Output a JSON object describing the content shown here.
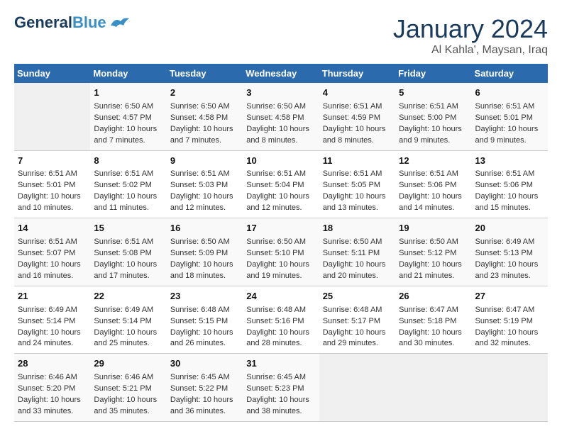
{
  "header": {
    "logo_general": "General",
    "logo_blue": "Blue",
    "month": "January 2024",
    "location": "Al Kahla', Maysan, Iraq"
  },
  "days_of_week": [
    "Sunday",
    "Monday",
    "Tuesday",
    "Wednesday",
    "Thursday",
    "Friday",
    "Saturday"
  ],
  "weeks": [
    [
      {
        "day": "",
        "sunrise": "",
        "sunset": "",
        "daylight": "",
        "empty": true
      },
      {
        "day": "1",
        "sunrise": "Sunrise: 6:50 AM",
        "sunset": "Sunset: 4:57 PM",
        "daylight": "Daylight: 10 hours and 7 minutes."
      },
      {
        "day": "2",
        "sunrise": "Sunrise: 6:50 AM",
        "sunset": "Sunset: 4:58 PM",
        "daylight": "Daylight: 10 hours and 7 minutes."
      },
      {
        "day": "3",
        "sunrise": "Sunrise: 6:50 AM",
        "sunset": "Sunset: 4:58 PM",
        "daylight": "Daylight: 10 hours and 8 minutes."
      },
      {
        "day": "4",
        "sunrise": "Sunrise: 6:51 AM",
        "sunset": "Sunset: 4:59 PM",
        "daylight": "Daylight: 10 hours and 8 minutes."
      },
      {
        "day": "5",
        "sunrise": "Sunrise: 6:51 AM",
        "sunset": "Sunset: 5:00 PM",
        "daylight": "Daylight: 10 hours and 9 minutes."
      },
      {
        "day": "6",
        "sunrise": "Sunrise: 6:51 AM",
        "sunset": "Sunset: 5:01 PM",
        "daylight": "Daylight: 10 hours and 9 minutes."
      }
    ],
    [
      {
        "day": "7",
        "sunrise": "Sunrise: 6:51 AM",
        "sunset": "Sunset: 5:01 PM",
        "daylight": "Daylight: 10 hours and 10 minutes."
      },
      {
        "day": "8",
        "sunrise": "Sunrise: 6:51 AM",
        "sunset": "Sunset: 5:02 PM",
        "daylight": "Daylight: 10 hours and 11 minutes."
      },
      {
        "day": "9",
        "sunrise": "Sunrise: 6:51 AM",
        "sunset": "Sunset: 5:03 PM",
        "daylight": "Daylight: 10 hours and 12 minutes."
      },
      {
        "day": "10",
        "sunrise": "Sunrise: 6:51 AM",
        "sunset": "Sunset: 5:04 PM",
        "daylight": "Daylight: 10 hours and 12 minutes."
      },
      {
        "day": "11",
        "sunrise": "Sunrise: 6:51 AM",
        "sunset": "Sunset: 5:05 PM",
        "daylight": "Daylight: 10 hours and 13 minutes."
      },
      {
        "day": "12",
        "sunrise": "Sunrise: 6:51 AM",
        "sunset": "Sunset: 5:06 PM",
        "daylight": "Daylight: 10 hours and 14 minutes."
      },
      {
        "day": "13",
        "sunrise": "Sunrise: 6:51 AM",
        "sunset": "Sunset: 5:06 PM",
        "daylight": "Daylight: 10 hours and 15 minutes."
      }
    ],
    [
      {
        "day": "14",
        "sunrise": "Sunrise: 6:51 AM",
        "sunset": "Sunset: 5:07 PM",
        "daylight": "Daylight: 10 hours and 16 minutes."
      },
      {
        "day": "15",
        "sunrise": "Sunrise: 6:51 AM",
        "sunset": "Sunset: 5:08 PM",
        "daylight": "Daylight: 10 hours and 17 minutes."
      },
      {
        "day": "16",
        "sunrise": "Sunrise: 6:50 AM",
        "sunset": "Sunset: 5:09 PM",
        "daylight": "Daylight: 10 hours and 18 minutes."
      },
      {
        "day": "17",
        "sunrise": "Sunrise: 6:50 AM",
        "sunset": "Sunset: 5:10 PM",
        "daylight": "Daylight: 10 hours and 19 minutes."
      },
      {
        "day": "18",
        "sunrise": "Sunrise: 6:50 AM",
        "sunset": "Sunset: 5:11 PM",
        "daylight": "Daylight: 10 hours and 20 minutes."
      },
      {
        "day": "19",
        "sunrise": "Sunrise: 6:50 AM",
        "sunset": "Sunset: 5:12 PM",
        "daylight": "Daylight: 10 hours and 21 minutes."
      },
      {
        "day": "20",
        "sunrise": "Sunrise: 6:49 AM",
        "sunset": "Sunset: 5:13 PM",
        "daylight": "Daylight: 10 hours and 23 minutes."
      }
    ],
    [
      {
        "day": "21",
        "sunrise": "Sunrise: 6:49 AM",
        "sunset": "Sunset: 5:14 PM",
        "daylight": "Daylight: 10 hours and 24 minutes."
      },
      {
        "day": "22",
        "sunrise": "Sunrise: 6:49 AM",
        "sunset": "Sunset: 5:14 PM",
        "daylight": "Daylight: 10 hours and 25 minutes."
      },
      {
        "day": "23",
        "sunrise": "Sunrise: 6:48 AM",
        "sunset": "Sunset: 5:15 PM",
        "daylight": "Daylight: 10 hours and 26 minutes."
      },
      {
        "day": "24",
        "sunrise": "Sunrise: 6:48 AM",
        "sunset": "Sunset: 5:16 PM",
        "daylight": "Daylight: 10 hours and 28 minutes."
      },
      {
        "day": "25",
        "sunrise": "Sunrise: 6:48 AM",
        "sunset": "Sunset: 5:17 PM",
        "daylight": "Daylight: 10 hours and 29 minutes."
      },
      {
        "day": "26",
        "sunrise": "Sunrise: 6:47 AM",
        "sunset": "Sunset: 5:18 PM",
        "daylight": "Daylight: 10 hours and 30 minutes."
      },
      {
        "day": "27",
        "sunrise": "Sunrise: 6:47 AM",
        "sunset": "Sunset: 5:19 PM",
        "daylight": "Daylight: 10 hours and 32 minutes."
      }
    ],
    [
      {
        "day": "28",
        "sunrise": "Sunrise: 6:46 AM",
        "sunset": "Sunset: 5:20 PM",
        "daylight": "Daylight: 10 hours and 33 minutes."
      },
      {
        "day": "29",
        "sunrise": "Sunrise: 6:46 AM",
        "sunset": "Sunset: 5:21 PM",
        "daylight": "Daylight: 10 hours and 35 minutes."
      },
      {
        "day": "30",
        "sunrise": "Sunrise: 6:45 AM",
        "sunset": "Sunset: 5:22 PM",
        "daylight": "Daylight: 10 hours and 36 minutes."
      },
      {
        "day": "31",
        "sunrise": "Sunrise: 6:45 AM",
        "sunset": "Sunset: 5:23 PM",
        "daylight": "Daylight: 10 hours and 38 minutes."
      },
      {
        "day": "",
        "sunrise": "",
        "sunset": "",
        "daylight": "",
        "empty": true
      },
      {
        "day": "",
        "sunrise": "",
        "sunset": "",
        "daylight": "",
        "empty": true
      },
      {
        "day": "",
        "sunrise": "",
        "sunset": "",
        "daylight": "",
        "empty": true
      }
    ]
  ]
}
